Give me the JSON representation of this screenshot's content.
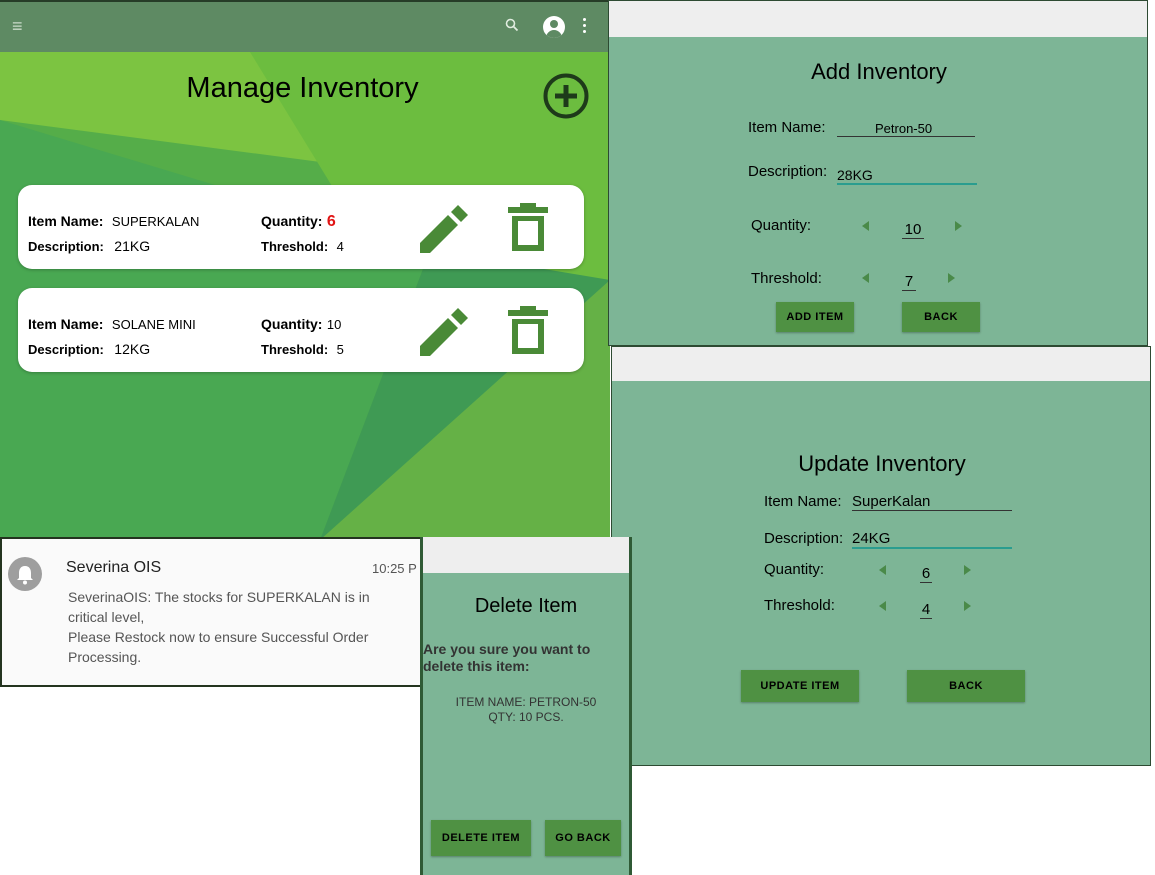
{
  "manage": {
    "title": "Manage Inventory",
    "colors": {
      "appbar": "#5e8a63",
      "accent": "#4a8a37",
      "critical": "#e11414"
    },
    "items": [
      {
        "name_label": "Item Name:",
        "name": "SUPERKALAN",
        "desc_label": "Description:",
        "desc": "21KG",
        "qty_label": "Quantity:",
        "qty": "6",
        "thr_label": "Threshold:",
        "thr": "4"
      },
      {
        "name_label": "Item Name:",
        "name": "SOLANE MINI",
        "desc_label": "Description:",
        "desc": "12KG",
        "qty_label": "Quantity:",
        "qty": "10",
        "thr_label": "Threshold:",
        "thr": "5"
      }
    ]
  },
  "add": {
    "title": "Add Inventory",
    "item_name_label": "Item Name:",
    "item_name": "Petron-50",
    "desc_label": "Description:",
    "desc": "28KG",
    "qty_label": "Quantity:",
    "qty": "10",
    "thr_label": "Threshold:",
    "thr": "7",
    "add_button": "ADD ITEM",
    "back_button": "BACK"
  },
  "update": {
    "title": "Update Inventory",
    "item_name_label": "Item Name:",
    "item_name": "SuperKalan",
    "desc_label": "Description:",
    "desc": "24KG",
    "qty_label": "Quantity:",
    "qty": "6",
    "thr_label": "Threshold:",
    "thr": "4",
    "update_button": "UPDATE ITEM",
    "back_button": "BACK"
  },
  "notification": {
    "app": "Severina OIS",
    "time": "10:25 P",
    "line1": "SeverinaOIS: The stocks for SUPERKALAN is in critical level,",
    "line2": "Please Restock now to ensure Successful Order Processing."
  },
  "delete": {
    "title": "Delete Item",
    "question": "Are you sure you want to delete this item:",
    "info_name": "ITEM NAME: PETRON-50",
    "info_qty": "QTY: 10 PCS.",
    "delete_button": "DELETE ITEM",
    "back_button": "GO BACK"
  }
}
